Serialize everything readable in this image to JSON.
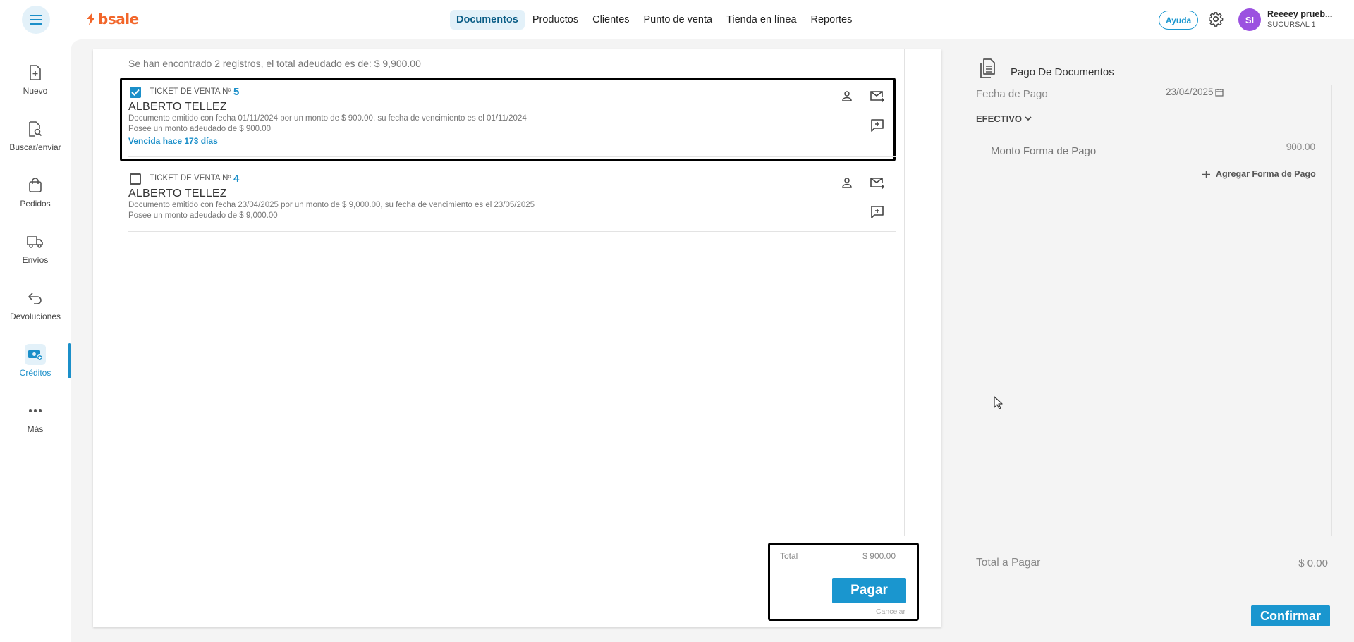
{
  "brand": {
    "name": "bsale",
    "color": "#f2662a"
  },
  "topnav": [
    {
      "label": "Documentos",
      "active": true
    },
    {
      "label": "Productos"
    },
    {
      "label": "Clientes"
    },
    {
      "label": "Punto de venta"
    },
    {
      "label": "Tienda en línea"
    },
    {
      "label": "Reportes"
    }
  ],
  "header": {
    "help_label": "Ayuda",
    "avatar_initials": "SI",
    "user_name": "Reeeey prueb...",
    "branch": "SUCURSAL 1"
  },
  "sidebar": {
    "items": [
      {
        "label": "Nuevo",
        "icon": "new-document-icon"
      },
      {
        "label": "Buscar/enviar",
        "icon": "search-document-icon"
      },
      {
        "label": "Pedidos",
        "icon": "shopping-bag-icon"
      },
      {
        "label": "Envíos",
        "icon": "truck-icon"
      },
      {
        "label": "Devoluciones",
        "icon": "return-arrow-icon"
      },
      {
        "label": "Créditos",
        "icon": "credit-cash-icon",
        "active": true
      },
      {
        "label": "Más",
        "icon": "more-dots-icon"
      }
    ]
  },
  "summary": "Se han encontrado 2 registros, el total adeudado es de: $ 9,900.00",
  "documents": [
    {
      "selected": true,
      "type_label": "TICKET DE VENTA Nº",
      "number": "5",
      "client": "ALBERTO TELLEZ",
      "detail": "Documento emitido con fecha 01/11/2024 por un monto de $ 900.00, su fecha de vencimiento es el 01/11/2024",
      "owed": "Posee un monto adeudado de $ 900.00",
      "overdue": "Vencida hace 173 días"
    },
    {
      "selected": false,
      "type_label": "TICKET DE VENTA Nº",
      "number": "4",
      "client": "ALBERTO TELLEZ",
      "detail": "Documento emitido con fecha 23/04/2025 por un monto de $ 9,000.00, su fecha de vencimiento es el 23/05/2025",
      "owed": "Posee un monto adeudado de $ 9,000.00",
      "overdue": ""
    }
  ],
  "totals": {
    "label": "Total",
    "value": "$ 900.00",
    "pay_label": "Pagar",
    "cancel_label": "Cancelar"
  },
  "payment": {
    "title": "Pago De Documentos",
    "date_label": "Fecha de Pago",
    "date_value": "23/04/2025",
    "method": "EFECTIVO",
    "amount_label": "Monto Forma de Pago",
    "amount_value": "900.00",
    "add_label": "Agregar Forma de Pago",
    "total_label": "Total a Pagar",
    "total_value": "$ 0.00",
    "confirm_label": "Confirmar"
  },
  "colors": {
    "accent": "#1a96cf",
    "brand": "#f2662a",
    "avatar": "#9b51e0"
  }
}
